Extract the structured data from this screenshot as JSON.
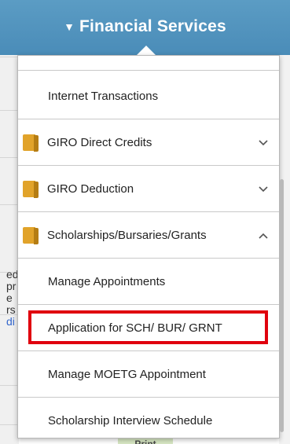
{
  "header": {
    "title": "Financial Services",
    "caret_icon": "caret-down-icon",
    "bg_color": "#4a8cb8"
  },
  "menu": {
    "items": [
      {
        "label": "Internet Transactions",
        "type": "sub"
      },
      {
        "label": "GIRO Direct Credits",
        "type": "folder",
        "expanded": false
      },
      {
        "label": "GIRO Deduction",
        "type": "folder",
        "expanded": false
      },
      {
        "label": "Scholarships/Bursaries/Grants",
        "type": "folder",
        "expanded": true
      },
      {
        "label": "Manage Appointments",
        "type": "sub"
      },
      {
        "label": "Application for SCH/ BUR/ GRNT",
        "type": "sub",
        "highlighted": true
      },
      {
        "label": "Manage MOETG Appointment",
        "type": "sub"
      },
      {
        "label": "Scholarship Interview Schedule",
        "type": "sub"
      }
    ],
    "folder_color": "#e1a32a",
    "highlight_color": "#e0000e"
  },
  "background": {
    "partial_text": [
      "ed",
      "pr",
      "e",
      "rs",
      "di"
    ],
    "print_button": "Print"
  }
}
